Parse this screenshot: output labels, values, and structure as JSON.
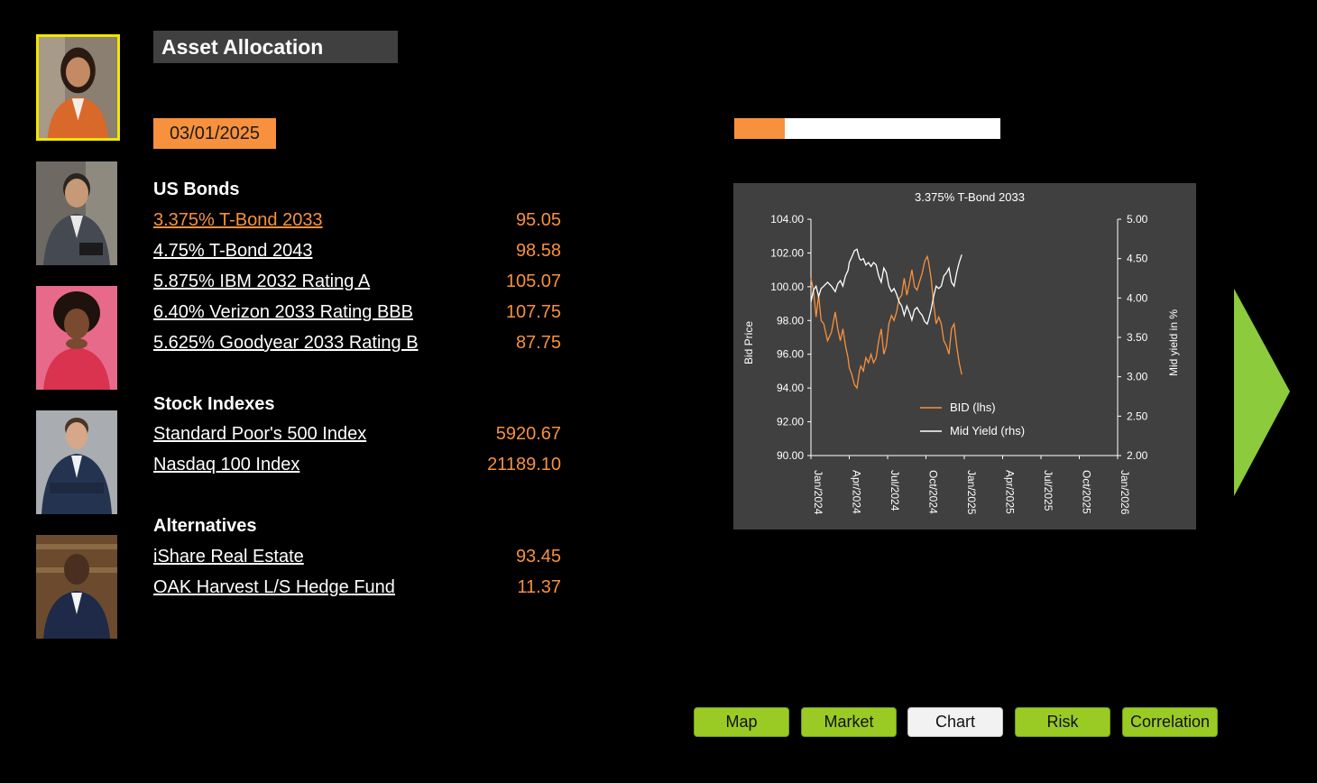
{
  "header": {
    "title": "Asset Allocation",
    "date": "03/01/2025"
  },
  "progress": {
    "value": 0.19
  },
  "sections": [
    {
      "heading": "US Bonds",
      "items": [
        {
          "name": "3.375% T-Bond 2033",
          "price": "95.05",
          "active": true
        },
        {
          "name": "4.75% T-Bond 2043",
          "price": "98.58"
        },
        {
          "name": "5.875% IBM 2032 Rating A",
          "price": "105.07"
        },
        {
          "name": "6.40% Verizon 2033 Rating BBB",
          "price": "107.75"
        },
        {
          "name": "5.625% Goodyear 2033 Rating B",
          "price": "87.75"
        }
      ]
    },
    {
      "heading": "Stock Indexes",
      "items": [
        {
          "name": "Standard Poor's 500 Index",
          "price": "5920.67"
        },
        {
          "name": "Nasdaq 100 Index",
          "price": "21189.10"
        }
      ]
    },
    {
      "heading": "Alternatives",
      "items": [
        {
          "name": "iShare Real Estate",
          "price": "93.45"
        },
        {
          "name": "OAK Harvest L/S Hedge Fund",
          "price": "11.37"
        }
      ]
    }
  ],
  "nav_buttons": [
    {
      "label": "Map"
    },
    {
      "label": "Market"
    },
    {
      "label": "Chart",
      "current": true
    },
    {
      "label": "Risk"
    },
    {
      "label": "Correlation"
    }
  ],
  "colors": {
    "accent": "#f7913d",
    "button_green": "#9acb24",
    "arrow_green": "#8ccb3c",
    "chart_bg": "#404040"
  },
  "chart_data": {
    "type": "line",
    "title": "3.375% T-Bond 2033",
    "ylabel": "Bid Price",
    "y2label": "Mid yield in %",
    "ylim": [
      90,
      104
    ],
    "y2lim": [
      2.0,
      5.0
    ],
    "yticks": [
      "90.00",
      "92.00",
      "94.00",
      "96.00",
      "98.00",
      "100.00",
      "102.00",
      "104.00"
    ],
    "y2ticks": [
      "2.00",
      "2.50",
      "3.00",
      "3.50",
      "4.00",
      "4.50",
      "5.00"
    ],
    "xticks": [
      "Jan/2024",
      "Apr/2024",
      "Jul/2024",
      "Oct/2024",
      "Jan/2025",
      "Apr/2025",
      "Jul/2025",
      "Oct/2025",
      "Jan/2026"
    ],
    "x_months": [
      0,
      24
    ],
    "legend_position": "lower-center",
    "series": [
      {
        "name": "BID (lhs)",
        "axis": "left",
        "color": "#f7913d",
        "x": [
          0,
          0.2,
          0.4,
          0.6,
          0.8,
          1.0,
          1.3,
          1.6,
          1.9,
          2.1,
          2.3,
          2.5,
          2.7,
          2.9,
          3.0,
          3.2,
          3.4,
          3.6,
          3.8,
          3.9,
          4.1,
          4.3,
          4.5,
          4.7,
          4.9,
          5.1,
          5.3,
          5.5,
          5.7,
          5.9,
          6.1,
          6.3,
          6.5,
          6.7,
          6.9,
          7.1,
          7.3,
          7.5,
          7.7,
          7.9,
          8.1,
          8.3,
          8.5,
          8.7,
          8.9,
          9.1,
          9.2,
          9.4,
          9.6,
          9.8,
          10.0,
          10.2,
          10.4,
          10.6,
          10.8,
          11.0,
          11.2,
          11.4,
          11.6,
          11.8
        ],
        "y": [
          100.5,
          99.8,
          98.2,
          99.5,
          98.0,
          97.8,
          96.8,
          97.3,
          98.5,
          97.5,
          96.8,
          97.5,
          96.5,
          95.8,
          95.2,
          94.8,
          94.2,
          94.0,
          95.0,
          95.3,
          95.0,
          95.8,
          95.5,
          96.0,
          95.5,
          95.8,
          96.8,
          97.5,
          96.0,
          96.5,
          97.8,
          98.3,
          98.0,
          98.5,
          99.3,
          99.5,
          100.5,
          99.5,
          100.2,
          101.0,
          100.0,
          99.8,
          100.3,
          100.8,
          101.5,
          101.8,
          101.5,
          100.5,
          99.0,
          97.8,
          98.2,
          97.8,
          96.8,
          96.5,
          96.0,
          97.5,
          97.8,
          96.5,
          95.5,
          94.8
        ]
      },
      {
        "name": "Mid Yield (rhs)",
        "axis": "right",
        "color": "#ffffff",
        "x": [
          0,
          0.2,
          0.4,
          0.6,
          0.8,
          1.0,
          1.3,
          1.6,
          1.9,
          2.1,
          2.3,
          2.5,
          2.7,
          2.9,
          3.0,
          3.2,
          3.4,
          3.6,
          3.8,
          3.9,
          4.1,
          4.3,
          4.5,
          4.7,
          4.9,
          5.1,
          5.3,
          5.5,
          5.7,
          5.9,
          6.1,
          6.3,
          6.5,
          6.7,
          6.9,
          7.1,
          7.3,
          7.5,
          7.7,
          7.9,
          8.1,
          8.3,
          8.5,
          8.7,
          8.9,
          9.1,
          9.2,
          9.4,
          9.6,
          9.8,
          10.0,
          10.2,
          10.4,
          10.6,
          10.8,
          11.0,
          11.2,
          11.4,
          11.6,
          11.8
        ],
        "y": [
          3.95,
          4.1,
          4.15,
          4.02,
          4.12,
          4.15,
          4.2,
          4.15,
          4.08,
          4.18,
          4.22,
          4.15,
          4.28,
          4.35,
          4.45,
          4.52,
          4.6,
          4.62,
          4.5,
          4.48,
          4.5,
          4.42,
          4.45,
          4.4,
          4.45,
          4.42,
          4.28,
          4.2,
          4.38,
          4.32,
          4.15,
          4.08,
          4.12,
          4.05,
          3.95,
          3.9,
          3.78,
          3.9,
          3.82,
          3.72,
          3.85,
          3.88,
          3.82,
          3.78,
          3.7,
          3.67,
          3.72,
          3.85,
          4.02,
          4.15,
          4.12,
          4.15,
          4.28,
          4.32,
          4.38,
          4.2,
          4.15,
          4.32,
          4.45,
          4.55
        ]
      }
    ]
  }
}
